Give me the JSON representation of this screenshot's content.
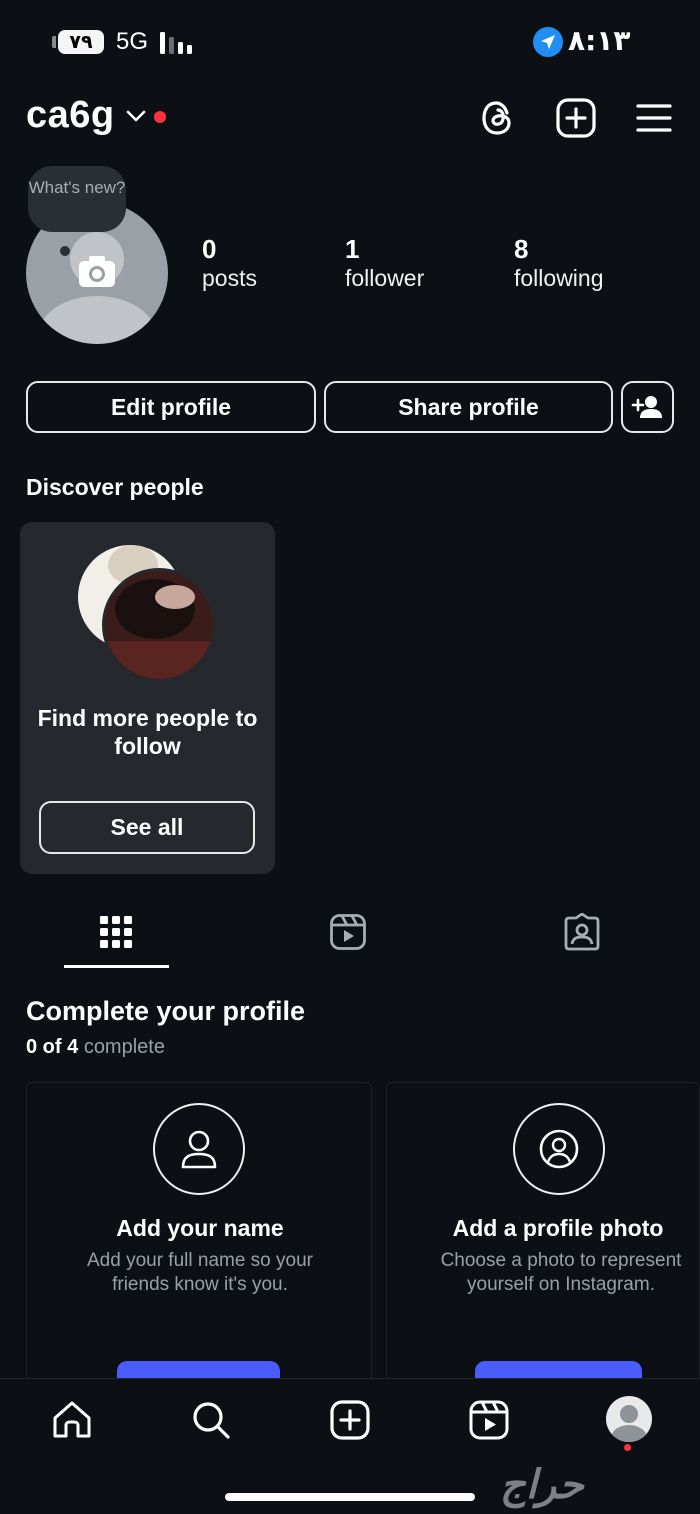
{
  "status_bar": {
    "battery": "٧٩",
    "network": "5G",
    "time": "٨:١٣"
  },
  "header": {
    "username": "ca6g"
  },
  "profile": {
    "note_bubble": "What's new?",
    "stats": [
      {
        "value": "0",
        "label": "posts"
      },
      {
        "value": "1",
        "label": "follower"
      },
      {
        "value": "8",
        "label": "following"
      }
    ]
  },
  "actions": {
    "edit_profile": "Edit profile",
    "share_profile": "Share profile"
  },
  "discover": {
    "title": "Discover people",
    "card_text": "Find more people to follow",
    "see_all": "See all"
  },
  "tabs": [
    "grid",
    "reels",
    "tagged"
  ],
  "complete_profile": {
    "title": "Complete your profile",
    "progress_done": "0 of 4",
    "progress_suffix": "complete",
    "cards": [
      {
        "title": "Add your name",
        "description": "Add your full name so your friends know it's you."
      },
      {
        "title": "Add a profile photo",
        "description": "Choose a photo to represent yourself on Instagram."
      }
    ]
  },
  "bottom_nav": [
    "home-icon",
    "search-icon",
    "create-icon",
    "reels-icon",
    "profile-avatar"
  ],
  "watermark": "حراج",
  "colors": {
    "background": "#0c1014",
    "accent": "#4a5df9",
    "notification": "#ff3040",
    "location": "#1f8ff5"
  }
}
